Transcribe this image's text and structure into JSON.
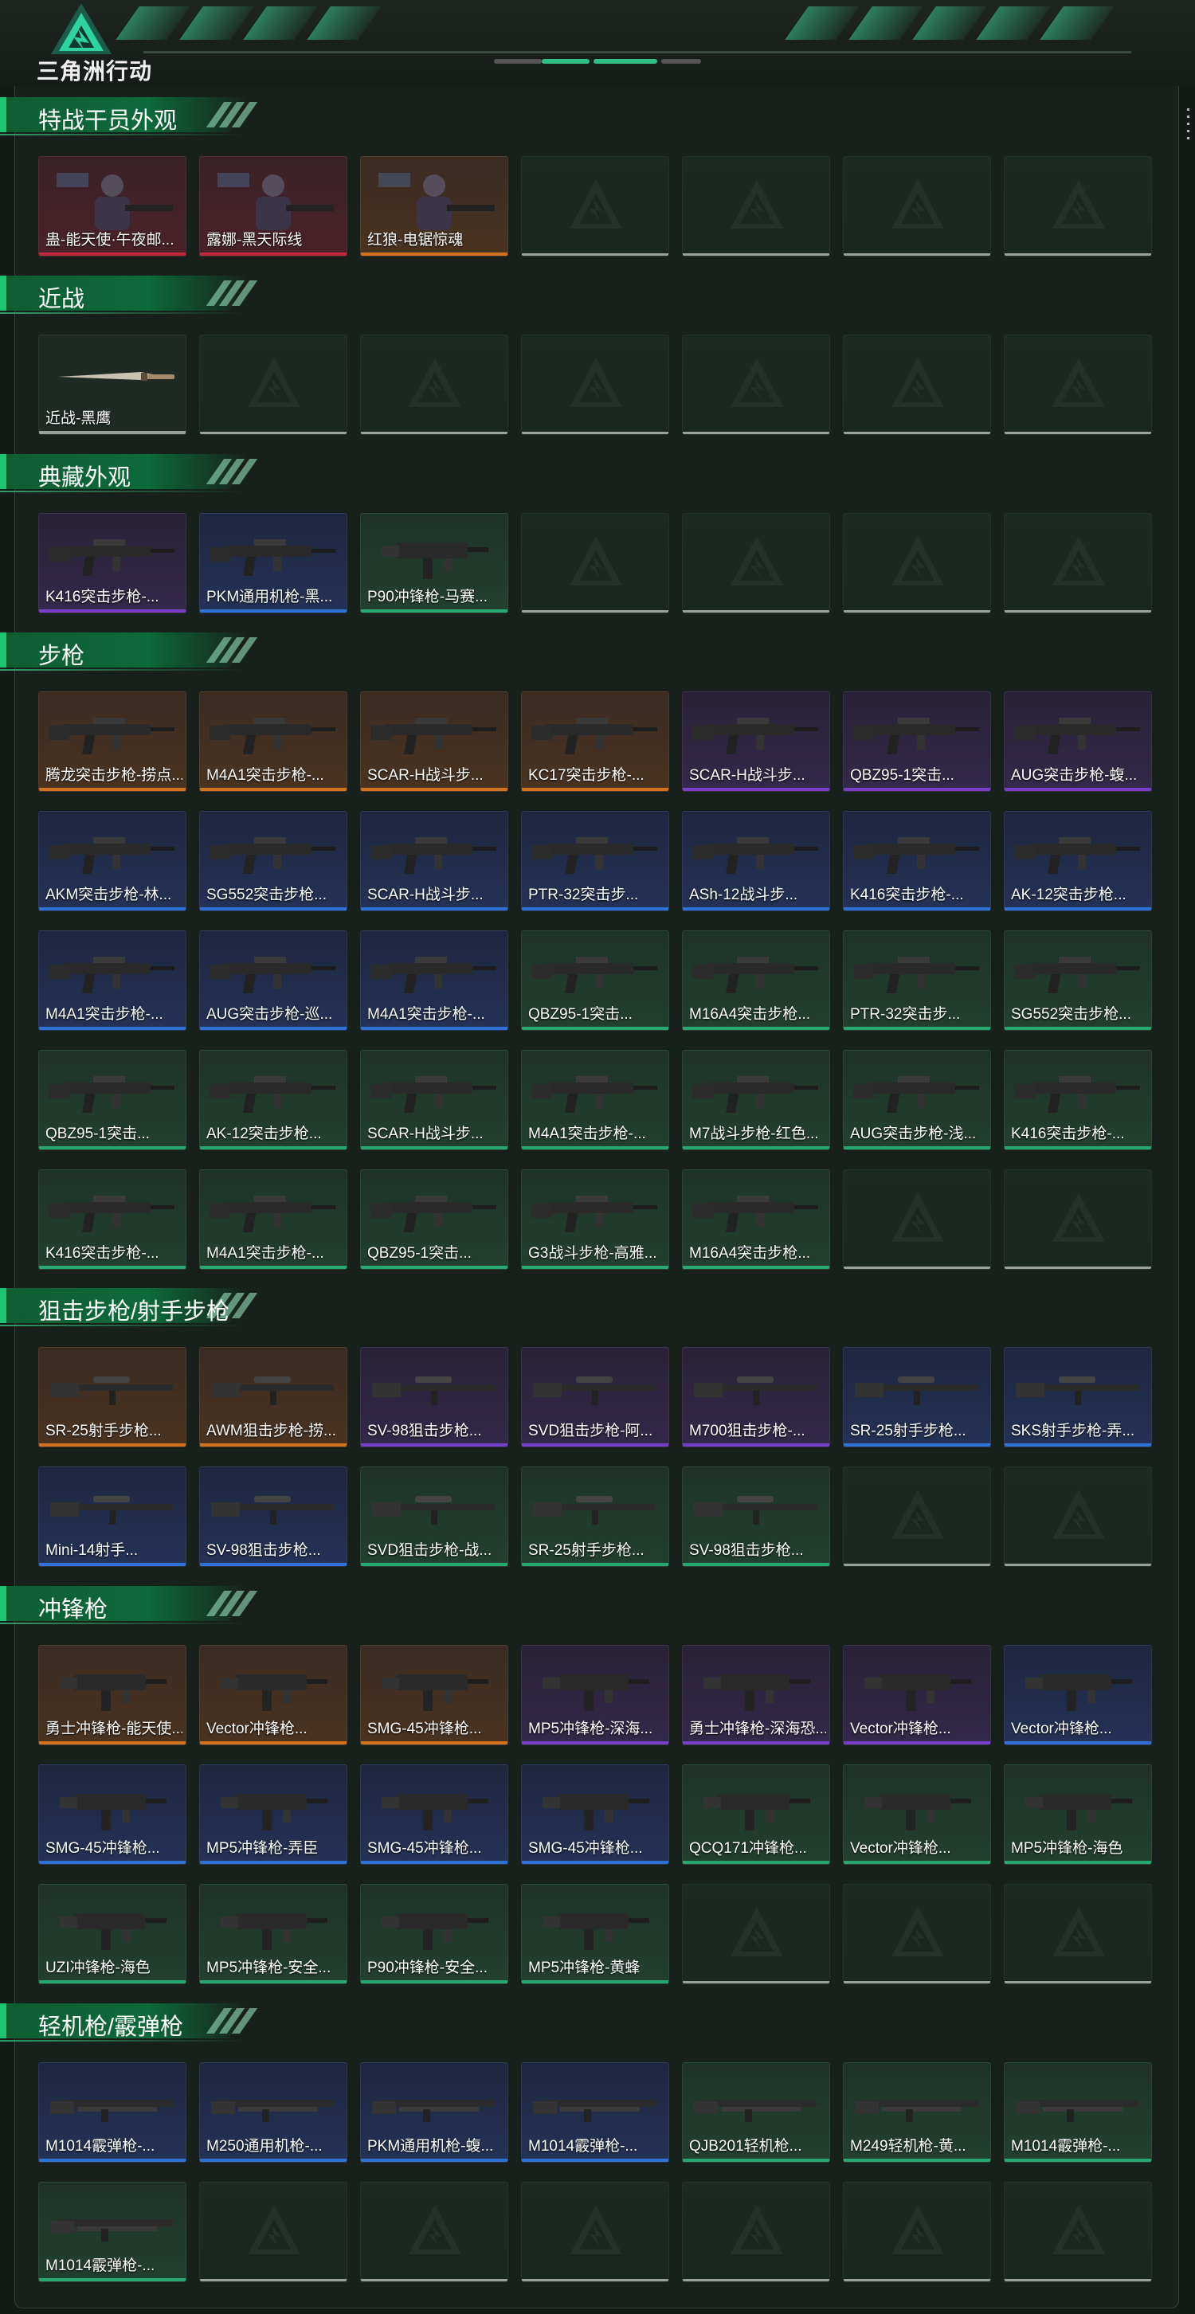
{
  "app": {
    "brand": "三角洲行动"
  },
  "colors": {
    "orange": "#d4731f",
    "purple": "#7a3fc8",
    "blue": "#2f72d6",
    "green": "#28a871",
    "red": "#c2283c",
    "empty": "#9aa19d"
  },
  "bg": {
    "orange": "linear-gradient(180deg,#3b2b22 0%,#4b3320 100%)",
    "purple": "linear-gradient(180deg,#2a2238 0%,#33284a 100%)",
    "blue": "linear-gradient(180deg,#1f2740 0%,#233256 100%)",
    "green": "linear-gradient(180deg,#1e3328 0%,#22402f 100%)",
    "red": "linear-gradient(180deg,#3a2228 0%,#4a2228 100%)"
  },
  "sections": [
    {
      "title": "特战干员外观",
      "slots": 7,
      "items": [
        {
          "label": "蛊-能天使·午夜邮...",
          "rarity": "red",
          "art": "char"
        },
        {
          "label": "露娜-黑天际线",
          "rarity": "red",
          "art": "char"
        },
        {
          "label": "红狼-电锯惊魂",
          "rarity": "orange",
          "art": "char"
        }
      ]
    },
    {
      "title": "近战",
      "slots": 7,
      "items": [
        {
          "label": "近战-黑鹰",
          "rarity": "empty",
          "art": "knife"
        }
      ]
    },
    {
      "title": "典藏外观",
      "slots": 7,
      "items": [
        {
          "label": "K416突击步枪-...",
          "rarity": "purple",
          "art": "rifle"
        },
        {
          "label": "PKM通用机枪-黑...",
          "rarity": "blue",
          "art": "rifle"
        },
        {
          "label": "P90冲锋枪-马赛...",
          "rarity": "green",
          "art": "smg"
        }
      ]
    },
    {
      "title": "步枪",
      "slots": 35,
      "items": [
        {
          "label": "腾龙突击步枪-捞点...",
          "rarity": "orange",
          "art": "rifle"
        },
        {
          "label": "M4A1突击步枪-...",
          "rarity": "orange",
          "art": "rifle"
        },
        {
          "label": "SCAR-H战斗步...",
          "rarity": "orange",
          "art": "rifle"
        },
        {
          "label": "KC17突击步枪-...",
          "rarity": "orange",
          "art": "rifle"
        },
        {
          "label": "SCAR-H战斗步...",
          "rarity": "purple",
          "art": "rifle"
        },
        {
          "label": "QBZ95-1突击...",
          "rarity": "purple",
          "art": "rifle"
        },
        {
          "label": "AUG突击步枪-蝮...",
          "rarity": "purple",
          "art": "rifle"
        },
        {
          "label": "AKM突击步枪-林...",
          "rarity": "blue",
          "art": "rifle"
        },
        {
          "label": "SG552突击步枪...",
          "rarity": "blue",
          "art": "rifle"
        },
        {
          "label": "SCAR-H战斗步...",
          "rarity": "blue",
          "art": "rifle"
        },
        {
          "label": "PTR-32突击步...",
          "rarity": "blue",
          "art": "rifle"
        },
        {
          "label": "ASh-12战斗步...",
          "rarity": "blue",
          "art": "rifle"
        },
        {
          "label": "K416突击步枪-...",
          "rarity": "blue",
          "art": "rifle"
        },
        {
          "label": "AK-12突击步枪...",
          "rarity": "blue",
          "art": "rifle"
        },
        {
          "label": "M4A1突击步枪-...",
          "rarity": "blue",
          "art": "rifle"
        },
        {
          "label": "AUG突击步枪-巡...",
          "rarity": "blue",
          "art": "rifle"
        },
        {
          "label": "M4A1突击步枪-...",
          "rarity": "blue",
          "art": "rifle"
        },
        {
          "label": "QBZ95-1突击...",
          "rarity": "green",
          "art": "rifle"
        },
        {
          "label": "M16A4突击步枪...",
          "rarity": "green",
          "art": "rifle"
        },
        {
          "label": "PTR-32突击步...",
          "rarity": "green",
          "art": "rifle"
        },
        {
          "label": "SG552突击步枪...",
          "rarity": "green",
          "art": "rifle"
        },
        {
          "label": "QBZ95-1突击...",
          "rarity": "green",
          "art": "rifle"
        },
        {
          "label": "AK-12突击步枪...",
          "rarity": "green",
          "art": "rifle"
        },
        {
          "label": "SCAR-H战斗步...",
          "rarity": "green",
          "art": "rifle"
        },
        {
          "label": "M4A1突击步枪-...",
          "rarity": "green",
          "art": "rifle"
        },
        {
          "label": "M7战斗步枪-红色...",
          "rarity": "green",
          "art": "rifle"
        },
        {
          "label": "AUG突击步枪-浅...",
          "rarity": "green",
          "art": "rifle"
        },
        {
          "label": "K416突击步枪-...",
          "rarity": "green",
          "art": "rifle"
        },
        {
          "label": "K416突击步枪-...",
          "rarity": "green",
          "art": "rifle"
        },
        {
          "label": "M4A1突击步枪-...",
          "rarity": "green",
          "art": "rifle"
        },
        {
          "label": "QBZ95-1突击...",
          "rarity": "green",
          "art": "rifle"
        },
        {
          "label": "G3战斗步枪-高雅...",
          "rarity": "green",
          "art": "rifle"
        },
        {
          "label": "M16A4突击步枪...",
          "rarity": "green",
          "art": "rifle"
        }
      ]
    },
    {
      "title": "狙击步枪/射手步枪",
      "slots": 14,
      "items": [
        {
          "label": "SR-25射手步枪...",
          "rarity": "orange",
          "art": "sniper"
        },
        {
          "label": "AWM狙击步枪-捞...",
          "rarity": "orange",
          "art": "sniper"
        },
        {
          "label": "SV-98狙击步枪...",
          "rarity": "purple",
          "art": "sniper"
        },
        {
          "label": "SVD狙击步枪-阿...",
          "rarity": "purple",
          "art": "sniper"
        },
        {
          "label": "M700狙击步枪-...",
          "rarity": "purple",
          "art": "sniper"
        },
        {
          "label": "SR-25射手步枪...",
          "rarity": "blue",
          "art": "sniper"
        },
        {
          "label": "SKS射手步枪-弄...",
          "rarity": "blue",
          "art": "sniper"
        },
        {
          "label": "Mini-14射手...",
          "rarity": "blue",
          "art": "sniper"
        },
        {
          "label": "SV-98狙击步枪...",
          "rarity": "blue",
          "art": "sniper"
        },
        {
          "label": "SVD狙击步枪-战...",
          "rarity": "green",
          "art": "sniper"
        },
        {
          "label": "SR-25射手步枪...",
          "rarity": "green",
          "art": "sniper"
        },
        {
          "label": "SV-98狙击步枪...",
          "rarity": "green",
          "art": "sniper"
        }
      ]
    },
    {
      "title": "冲锋枪",
      "slots": 21,
      "items": [
        {
          "label": "勇士冲锋枪-能天使...",
          "rarity": "orange",
          "art": "smg"
        },
        {
          "label": "Vector冲锋枪...",
          "rarity": "orange",
          "art": "smg"
        },
        {
          "label": "SMG-45冲锋枪...",
          "rarity": "orange",
          "art": "smg"
        },
        {
          "label": "MP5冲锋枪-深海...",
          "rarity": "purple",
          "art": "smg"
        },
        {
          "label": "勇士冲锋枪-深海恐...",
          "rarity": "purple",
          "art": "smg"
        },
        {
          "label": "Vector冲锋枪...",
          "rarity": "purple",
          "art": "smg"
        },
        {
          "label": "Vector冲锋枪...",
          "rarity": "blue",
          "art": "smg"
        },
        {
          "label": "SMG-45冲锋枪...",
          "rarity": "blue",
          "art": "smg"
        },
        {
          "label": "MP5冲锋枪-弄臣",
          "rarity": "blue",
          "art": "smg"
        },
        {
          "label": "SMG-45冲锋枪...",
          "rarity": "blue",
          "art": "smg"
        },
        {
          "label": "SMG-45冲锋枪...",
          "rarity": "blue",
          "art": "smg"
        },
        {
          "label": "QCQ171冲锋枪...",
          "rarity": "green",
          "art": "smg"
        },
        {
          "label": "Vector冲锋枪...",
          "rarity": "green",
          "art": "smg"
        },
        {
          "label": "MP5冲锋枪-海色",
          "rarity": "green",
          "art": "smg"
        },
        {
          "label": "UZI冲锋枪-海色",
          "rarity": "green",
          "art": "smg"
        },
        {
          "label": "MP5冲锋枪-安全...",
          "rarity": "green",
          "art": "smg"
        },
        {
          "label": "P90冲锋枪-安全...",
          "rarity": "green",
          "art": "smg"
        },
        {
          "label": "MP5冲锋枪-黄蜂",
          "rarity": "green",
          "art": "smg"
        }
      ]
    },
    {
      "title": "轻机枪/霰弹枪",
      "slots": 14,
      "items": [
        {
          "label": "M1014霰弹枪-...",
          "rarity": "blue",
          "art": "shotgun"
        },
        {
          "label": "M250通用机枪-...",
          "rarity": "blue",
          "art": "shotgun"
        },
        {
          "label": "PKM通用机枪-蝮...",
          "rarity": "blue",
          "art": "shotgun"
        },
        {
          "label": "M1014霰弹枪-...",
          "rarity": "blue",
          "art": "shotgun"
        },
        {
          "label": "QJB201轻机枪...",
          "rarity": "green",
          "art": "shotgun"
        },
        {
          "label": "M249轻机枪-黄...",
          "rarity": "green",
          "art": "shotgun"
        },
        {
          "label": "M1014霰弹枪-...",
          "rarity": "green",
          "art": "shotgun"
        },
        {
          "label": "M1014霰弹枪-...",
          "rarity": "green",
          "art": "shotgun"
        }
      ]
    }
  ]
}
